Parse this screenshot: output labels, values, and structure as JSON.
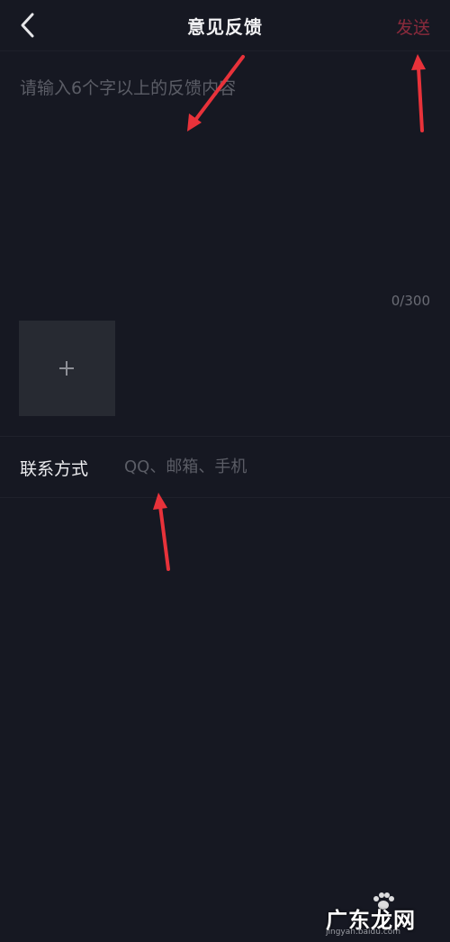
{
  "header": {
    "back_icon": "chevron-left-icon",
    "title": "意见反馈",
    "send_label": "发送",
    "send_color": "#8a2a3c"
  },
  "feedback": {
    "placeholder": "请输入6个字以上的反馈内容",
    "value": "",
    "counter": "0/300"
  },
  "attachment": {
    "add_icon": "plus-icon"
  },
  "contact": {
    "label": "联系方式",
    "placeholder": "QQ、邮箱、手机",
    "value": ""
  },
  "annotations": {
    "arrow_color": "#e8323a"
  },
  "watermark": {
    "brand": "广东龙网",
    "url": "jingyan.baidu.com"
  },
  "colors": {
    "background": "#161822",
    "tile": "#272a32",
    "placeholder_text": "#5b5d66"
  }
}
